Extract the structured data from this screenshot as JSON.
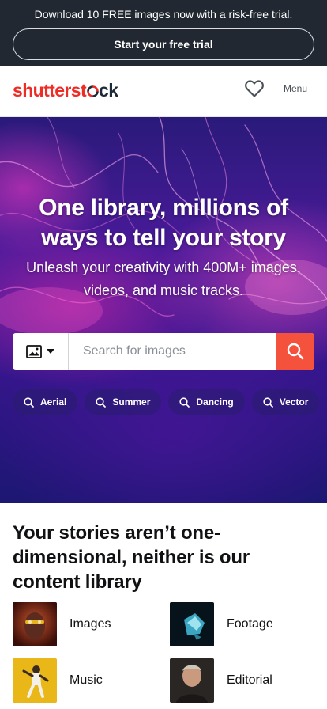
{
  "promo": {
    "text": "Download 10 FREE images now with a risk-free trial.",
    "cta_label": "Start your free trial"
  },
  "header": {
    "logo_part1": "shutterst",
    "logo_part2": "ck",
    "favorites_icon": "heart-icon",
    "menu_label": "Menu"
  },
  "hero": {
    "title": "One library, millions of ways to tell your story",
    "subtitle": "Unleash your creativity with 400M+ images, videos, and music tracks.",
    "search": {
      "type_icon": "image-icon",
      "placeholder": "Search for images",
      "value": "",
      "submit_icon": "search-icon"
    },
    "chips": [
      {
        "label": "Aerial"
      },
      {
        "label": "Summer"
      },
      {
        "label": "Dancing"
      },
      {
        "label": "Vector"
      }
    ]
  },
  "stories": {
    "title": "Your stories aren’t one-dimensional, neither is our content library",
    "categories": [
      {
        "label": "Images"
      },
      {
        "label": "Footage"
      },
      {
        "label": "Music"
      },
      {
        "label": "Editorial"
      }
    ]
  },
  "colors": {
    "brand_red": "#ee2b24",
    "search_button": "#f5523d",
    "promo_background": "#212831"
  }
}
